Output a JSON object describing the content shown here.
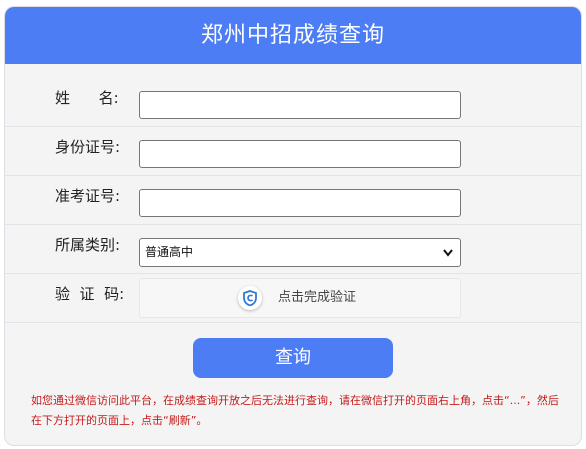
{
  "header": {
    "title": "郑州中招成绩查询"
  },
  "form": {
    "name_label": "姓      名:",
    "id_label": "身份证号:",
    "exam_label": "准考证号:",
    "category_label": "所属类别:",
    "category_value": "普通高中",
    "captcha_label": "验  证  码:",
    "captcha_text": "点击完成验证"
  },
  "submit_label": "查询",
  "notice": "如您通过微信访问此平台，在成绩查询开放之后无法进行查询，请在微信打开的页面右上角，点击“...”，然后在下方打开的页面上，点击“刷新”。",
  "colors": {
    "accent": "#4d7df5",
    "notice": "#c41a1a"
  }
}
